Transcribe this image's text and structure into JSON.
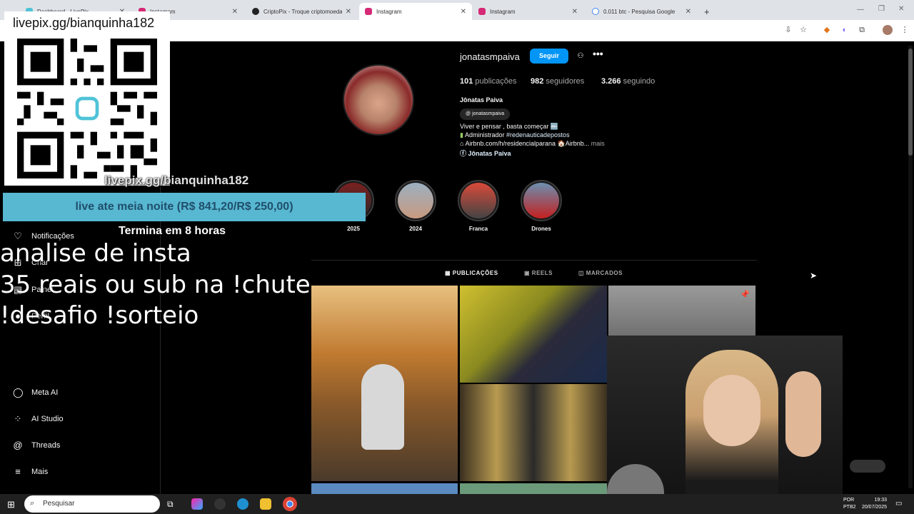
{
  "browser": {
    "tabs": [
      {
        "title": "Dashboard - LivePix",
        "active": false
      },
      {
        "title": "Instagram",
        "active": false
      },
      {
        "title": "CriptoPix - Troque criptomoeda",
        "active": false
      },
      {
        "title": "Instagram",
        "active": true
      },
      {
        "title": "Instagram",
        "active": false
      },
      {
        "title": "0.011 btc - Pesquisa Google",
        "active": false
      }
    ],
    "new_tab": "+"
  },
  "overlay": {
    "qr_url": "livepix.gg/bianquinha182",
    "qr_url_ghost": "livepix.gg/bianquinha182",
    "goal": "live ate meia noite (R$ 841,20/R$ 250,00)",
    "goal_end": "Termina em 8 horas",
    "line1": "analise de insta",
    "line2": "35 reais ou sub na !chute",
    "line3": "!desafio !sorteio"
  },
  "sidebar": {
    "items": [
      {
        "label": "Notificações",
        "icon": "heart-icon"
      },
      {
        "label": "Criar",
        "icon": "plus-icon"
      },
      {
        "label": "Painel",
        "icon": "dashboard-icon"
      },
      {
        "label": "Perfil",
        "icon": "profile-icon"
      },
      {
        "label": "Meta AI",
        "icon": "meta-ai-icon"
      },
      {
        "label": "AI Studio",
        "icon": "ai-studio-icon"
      },
      {
        "label": "Threads",
        "icon": "threads-icon"
      },
      {
        "label": "Mais",
        "icon": "menu-icon"
      }
    ]
  },
  "profile": {
    "username": "jonatasmpaiva",
    "follow_label": "Seguir",
    "posts_count": "101",
    "posts_label": "publicações",
    "followers_count": "982",
    "followers_label": "seguidores",
    "following_count": "3.266",
    "following_label": "seguindo",
    "full_name": "Jônatas Paiva",
    "threads_handle": "jonatasmpaiva",
    "bio_line1": "Viver e pensar , basta começar 🔤",
    "bio_line2_prefix": "Administrador ",
    "bio_line2_tag": "#redenauticadepostos",
    "bio_line3": "Airbnb.com/h/residencialparana 🏠Airbnb...",
    "bio_more": "mais",
    "bio_line4": "Jônatas Paiva"
  },
  "stories": [
    {
      "label": "2025"
    },
    {
      "label": "2024"
    },
    {
      "label": "Franca"
    },
    {
      "label": "Drones"
    }
  ],
  "profile_tabs": [
    {
      "label": "PUBLICAÇÕES",
      "active": true
    },
    {
      "label": "REELS",
      "active": false
    },
    {
      "label": "MARCADOS",
      "active": false
    }
  ],
  "taskbar": {
    "search_placeholder": "Pesquisar",
    "lang_line1": "POR",
    "lang_line2": "PTB2",
    "time": "19:33",
    "date": "20/07/2025"
  },
  "colors": {
    "accent_blue": "#0095f6",
    "goal_bar": "#58b7d1"
  }
}
